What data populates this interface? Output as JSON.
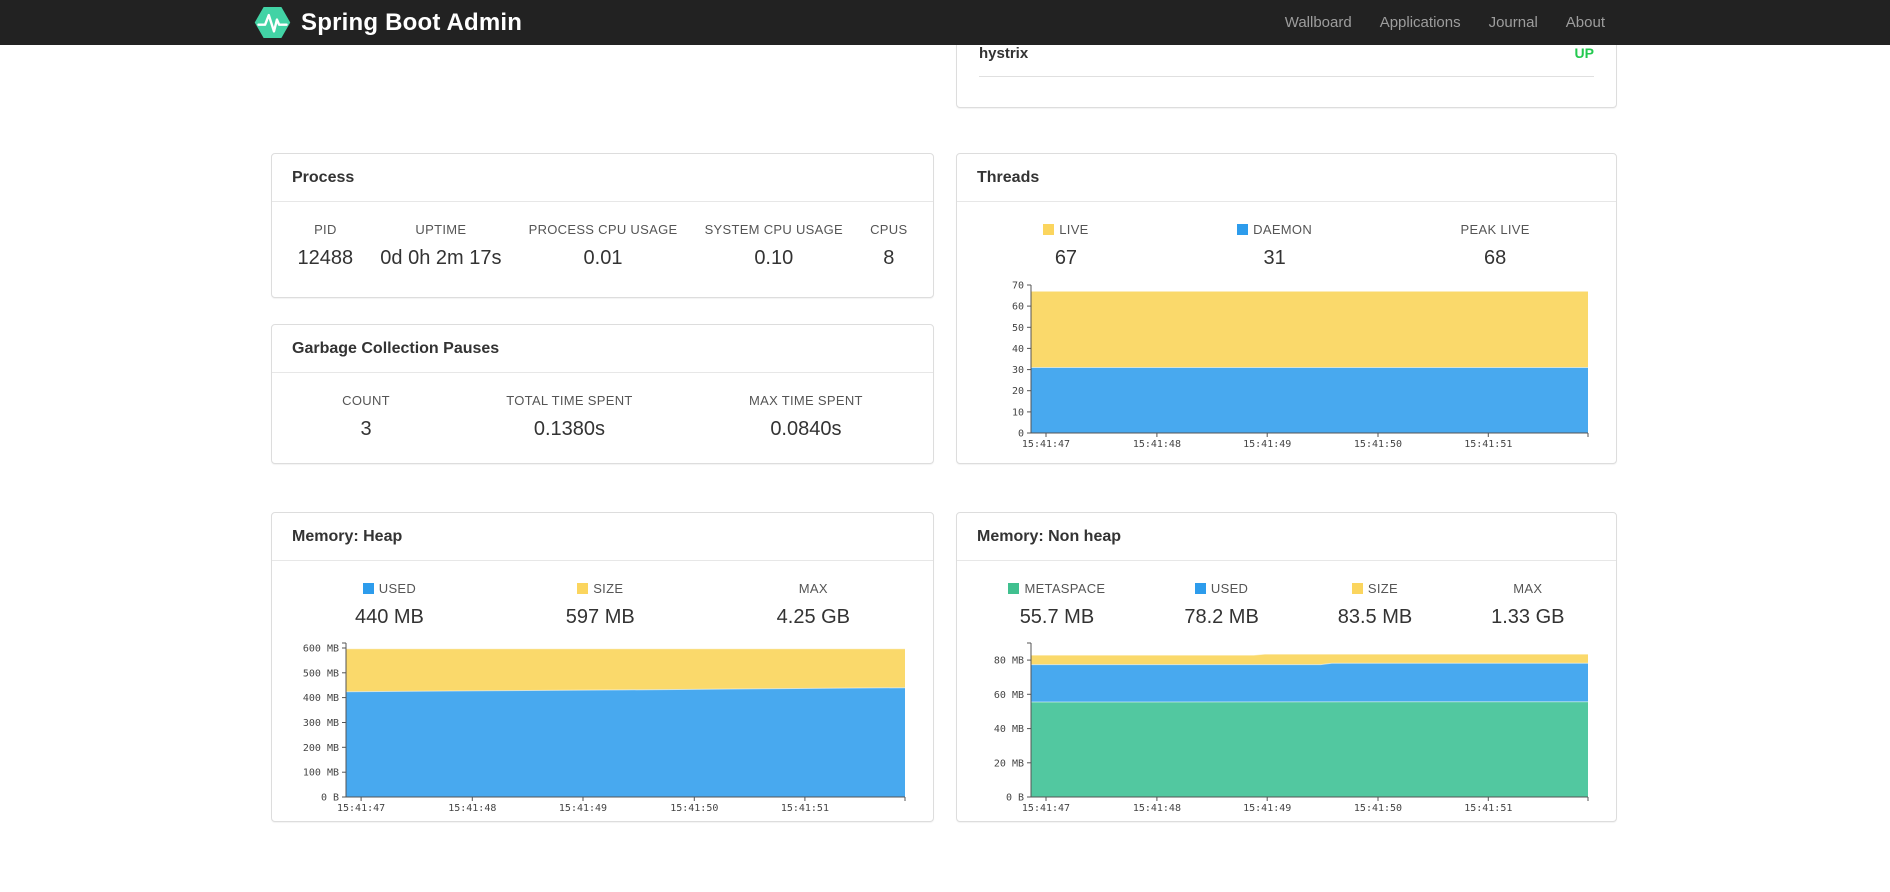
{
  "navbar": {
    "brand": "Spring Boot Admin",
    "links": [
      {
        "label": "Wallboard"
      },
      {
        "label": "Applications"
      },
      {
        "label": "Journal"
      },
      {
        "label": "About"
      }
    ],
    "bg_color": "#222222",
    "logo_color": "#42d3a5"
  },
  "health_panel": {
    "service": "hystrix",
    "status": "UP",
    "status_color": "#23c94f"
  },
  "process_panel": {
    "title": "Process",
    "stats": [
      {
        "label": "PID",
        "value": "12488"
      },
      {
        "label": "UPTIME",
        "value": "0d 0h 2m 17s"
      },
      {
        "label": "PROCESS CPU USAGE",
        "value": "0.01"
      },
      {
        "label": "SYSTEM CPU USAGE",
        "value": "0.10"
      },
      {
        "label": "CPUS",
        "value": "8"
      }
    ]
  },
  "gc_panel": {
    "title": "Garbage Collection Pauses",
    "stats": [
      {
        "label": "COUNT",
        "value": "3"
      },
      {
        "label": "TOTAL TIME SPENT",
        "value": "0.1380s"
      },
      {
        "label": "MAX TIME SPENT",
        "value": "0.0840s"
      }
    ]
  },
  "threads_panel": {
    "title": "Threads",
    "stats": [
      {
        "label": "LIVE",
        "value": "67",
        "swatch": "#fbd55e"
      },
      {
        "label": "DAEMON",
        "value": "31",
        "swatch": "#2d9cec"
      },
      {
        "label": "PEAK LIVE",
        "value": "68"
      }
    ]
  },
  "heap_panel": {
    "title": "Memory: Heap",
    "stats": [
      {
        "label": "USED",
        "value": "440 MB",
        "swatch": "#2d9cec"
      },
      {
        "label": "SIZE",
        "value": "597 MB",
        "swatch": "#fbd55e"
      },
      {
        "label": "MAX",
        "value": "4.25 GB"
      }
    ]
  },
  "nonheap_panel": {
    "title": "Memory: Non heap",
    "stats": [
      {
        "label": "METASPACE",
        "value": "55.7 MB",
        "swatch": "#40c08f"
      },
      {
        "label": "USED",
        "value": "78.2 MB",
        "swatch": "#2d9cec"
      },
      {
        "label": "SIZE",
        "value": "83.5 MB",
        "swatch": "#fbd55e"
      },
      {
        "label": "MAX",
        "value": "1.33 GB"
      }
    ]
  },
  "chart_data": [
    {
      "type": "area",
      "title": "Threads",
      "ylim": [
        0,
        70
      ],
      "grid": false,
      "legend_position": "above",
      "yticks": [
        {
          "v": 0,
          "label": "0"
        },
        {
          "v": 10,
          "label": "10"
        },
        {
          "v": 20,
          "label": "20"
        },
        {
          "v": 30,
          "label": "30"
        },
        {
          "v": 40,
          "label": "40"
        },
        {
          "v": 50,
          "label": "50"
        },
        {
          "v": 60,
          "label": "60"
        },
        {
          "v": 70,
          "label": "70"
        }
      ],
      "xticks": [
        {
          "f": 0.027,
          "label": "15:41:47"
        },
        {
          "f": 0.226,
          "label": "15:41:48"
        },
        {
          "f": 0.424,
          "label": "15:41:49"
        },
        {
          "f": 0.623,
          "label": "15:41:50"
        },
        {
          "f": 0.821,
          "label": "15:41:51"
        }
      ],
      "series": [
        {
          "name": "DAEMON",
          "color": "#48a9ef",
          "points": [
            [
              0,
              31
            ],
            [
              1,
              31
            ]
          ]
        },
        {
          "name": "LIVE",
          "color": "#fad96b",
          "points": [
            [
              0,
              67
            ],
            [
              1,
              67
            ]
          ]
        }
      ]
    },
    {
      "type": "area",
      "title": "Memory: Heap",
      "ylim": [
        0,
        620
      ],
      "grid": false,
      "legend_position": "above",
      "yticks": [
        {
          "v": 0,
          "label": "0 B"
        },
        {
          "v": 100,
          "label": "100 MB"
        },
        {
          "v": 200,
          "label": "200 MB"
        },
        {
          "v": 300,
          "label": "300 MB"
        },
        {
          "v": 400,
          "label": "400 MB"
        },
        {
          "v": 500,
          "label": "500 MB"
        },
        {
          "v": 600,
          "label": "600 MB"
        }
      ],
      "xticks": [
        {
          "f": 0.027,
          "label": "15:41:47"
        },
        {
          "f": 0.226,
          "label": "15:41:48"
        },
        {
          "f": 0.424,
          "label": "15:41:49"
        },
        {
          "f": 0.623,
          "label": "15:41:50"
        },
        {
          "f": 0.821,
          "label": "15:41:51"
        }
      ],
      "series": [
        {
          "name": "USED",
          "color": "#48a9ef",
          "points": [
            [
              0,
              424
            ],
            [
              0.25,
              428
            ],
            [
              0.5,
              431
            ],
            [
              0.75,
              436
            ],
            [
              1,
              440
            ]
          ]
        },
        {
          "name": "SIZE",
          "color": "#fad96b",
          "points": [
            [
              0,
              597
            ],
            [
              1,
              597
            ]
          ]
        }
      ]
    },
    {
      "type": "area",
      "title": "Memory: Non heap",
      "ylim": [
        0,
        90
      ],
      "grid": false,
      "legend_position": "above",
      "yticks": [
        {
          "v": 0,
          "label": "0 B"
        },
        {
          "v": 20,
          "label": "20 MB"
        },
        {
          "v": 40,
          "label": "40 MB"
        },
        {
          "v": 60,
          "label": "60 MB"
        },
        {
          "v": 80,
          "label": "80 MB"
        }
      ],
      "xticks": [
        {
          "f": 0.027,
          "label": "15:41:47"
        },
        {
          "f": 0.226,
          "label": "15:41:48"
        },
        {
          "f": 0.424,
          "label": "15:41:49"
        },
        {
          "f": 0.623,
          "label": "15:41:50"
        },
        {
          "f": 0.821,
          "label": "15:41:51"
        }
      ],
      "series": [
        {
          "name": "METASPACE",
          "color": "#52c8a0",
          "points": [
            [
              0,
              55.5
            ],
            [
              1,
              55.7
            ]
          ]
        },
        {
          "name": "USED",
          "color": "#48a9ef",
          "points": [
            [
              0,
              77.4
            ],
            [
              0.52,
              77.4
            ],
            [
              0.54,
              78.2
            ],
            [
              1,
              78.2
            ]
          ]
        },
        {
          "name": "SIZE",
          "color": "#fad96b",
          "points": [
            [
              0,
              82.9
            ],
            [
              0.4,
              82.9
            ],
            [
              0.42,
              83.5
            ],
            [
              1,
              83.5
            ]
          ]
        }
      ]
    }
  ]
}
